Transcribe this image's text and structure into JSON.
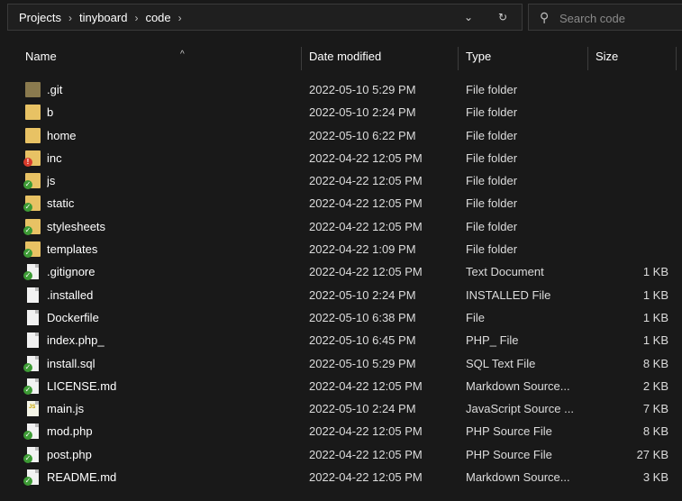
{
  "breadcrumb": [
    "Projects",
    "tinyboard",
    "code"
  ],
  "breadcrumb_separator": "›",
  "search": {
    "placeholder": "Search code"
  },
  "columns": {
    "name": "Name",
    "date": "Date modified",
    "type": "Type",
    "size": "Size"
  },
  "colors": {
    "background": "#191919",
    "folder": "#e8c264",
    "sync_green": "#3d9b35",
    "error_red": "#d83b2b"
  },
  "files": [
    {
      "name": ".git",
      "date": "2022-05-10 5:29 PM",
      "type": "File folder",
      "size": "",
      "icon": "folder-dark-icon"
    },
    {
      "name": "b",
      "date": "2022-05-10 2:24 PM",
      "type": "File folder",
      "size": "",
      "icon": "folder-icon"
    },
    {
      "name": "home",
      "date": "2022-05-10 6:22 PM",
      "type": "File folder",
      "size": "",
      "icon": "folder-icon"
    },
    {
      "name": "inc",
      "date": "2022-04-22 12:05 PM",
      "type": "File folder",
      "size": "",
      "icon": "folder-error-icon"
    },
    {
      "name": "js",
      "date": "2022-04-22 12:05 PM",
      "type": "File folder",
      "size": "",
      "icon": "folder-synced-icon"
    },
    {
      "name": "static",
      "date": "2022-04-22 12:05 PM",
      "type": "File folder",
      "size": "",
      "icon": "folder-synced-icon"
    },
    {
      "name": "stylesheets",
      "date": "2022-04-22 12:05 PM",
      "type": "File folder",
      "size": "",
      "icon": "folder-synced-icon"
    },
    {
      "name": "templates",
      "date": "2022-04-22 1:09 PM",
      "type": "File folder",
      "size": "",
      "icon": "folder-synced-icon"
    },
    {
      "name": ".gitignore",
      "date": "2022-04-22 12:05 PM",
      "type": "Text Document",
      "size": "1 KB",
      "icon": "file-synced-icon"
    },
    {
      "name": ".installed",
      "date": "2022-05-10 2:24 PM",
      "type": "INSTALLED File",
      "size": "1 KB",
      "icon": "file-icon"
    },
    {
      "name": "Dockerfile",
      "date": "2022-05-10 6:38 PM",
      "type": "File",
      "size": "1 KB",
      "icon": "file-icon"
    },
    {
      "name": "index.php_",
      "date": "2022-05-10 6:45 PM",
      "type": "PHP_ File",
      "size": "1 KB",
      "icon": "file-icon"
    },
    {
      "name": "install.sql",
      "date": "2022-05-10 5:29 PM",
      "type": "SQL Text File",
      "size": "8 KB",
      "icon": "file-synced-icon"
    },
    {
      "name": "LICENSE.md",
      "date": "2022-04-22 12:05 PM",
      "type": "Markdown Source...",
      "size": "2 KB",
      "icon": "file-synced-icon"
    },
    {
      "name": "main.js",
      "date": "2022-05-10 2:24 PM",
      "type": "JavaScript Source ...",
      "size": "7 KB",
      "icon": "js-file-icon"
    },
    {
      "name": "mod.php",
      "date": "2022-04-22 12:05 PM",
      "type": "PHP Source File",
      "size": "8 KB",
      "icon": "file-synced-icon"
    },
    {
      "name": "post.php",
      "date": "2022-04-22 12:05 PM",
      "type": "PHP Source File",
      "size": "27 KB",
      "icon": "file-synced-icon"
    },
    {
      "name": "README.md",
      "date": "2022-04-22 12:05 PM",
      "type": "Markdown Source...",
      "size": "3 KB",
      "icon": "file-synced-icon"
    }
  ]
}
